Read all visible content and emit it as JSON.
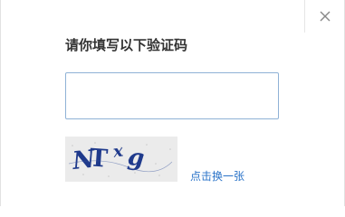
{
  "dialog": {
    "title": "请你填写以下验证码",
    "input": {
      "value": "",
      "placeholder": ""
    },
    "captcha": {
      "text": "NTxg",
      "chars": [
        "N",
        "T",
        "x",
        "g"
      ],
      "icon": "captcha-image"
    },
    "refresh_label": "点击换一张",
    "close_icon": "close-icon"
  },
  "colors": {
    "title": "#333333",
    "input_border": "#8fb2d6",
    "link": "#2a73c8",
    "captcha_bg": "#ebebeb",
    "captcha_text": "#1f3a8c"
  }
}
